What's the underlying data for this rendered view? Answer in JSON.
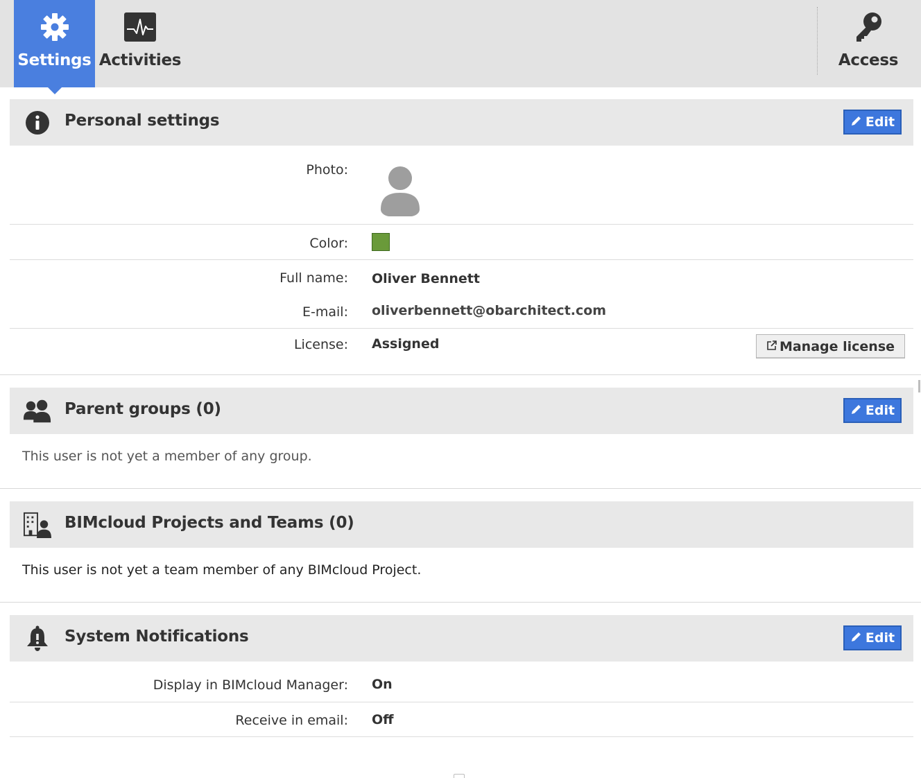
{
  "tabs": {
    "settings": {
      "label": "Settings",
      "icon": "gear-icon",
      "active": true
    },
    "activities": {
      "label": "Activities",
      "icon": "activity-monitor-icon"
    },
    "access": {
      "label": "Access",
      "icon": "key-icon"
    }
  },
  "personal_settings": {
    "title": "Personal settings",
    "icon": "info-icon",
    "edit_label": "Edit",
    "photo_label": "Photo:",
    "color_label": "Color:",
    "color_value": "#6a9a3a",
    "full_name_label": "Full name:",
    "full_name": "Oliver Bennett",
    "email_label": "E-mail:",
    "email": "oliverbennett@obarchitect.com",
    "license_label": "License:",
    "license_value": "Assigned",
    "manage_license_label": "Manage license"
  },
  "parent_groups": {
    "title": "Parent groups (0)",
    "icon": "users-icon",
    "edit_label": "Edit",
    "empty_text": "This user is not yet a member of any group."
  },
  "projects_teams": {
    "title": "BIMcloud Projects and Teams (0)",
    "icon": "building-user-icon",
    "empty_text": "This user is not yet a team member of any BIMcloud Project."
  },
  "system_notifications": {
    "title": "System Notifications",
    "icon": "bell-icon",
    "edit_label": "Edit",
    "display_label": "Display in BIMcloud Manager:",
    "display_value": "On",
    "email_label": "Receive in email:",
    "email_value": "Off"
  },
  "colors": {
    "accent": "#4a7fdf",
    "edit_button": "#3d77dd",
    "header_bg": "#e8e8e8",
    "topbar_bg": "#e3e3e3"
  }
}
